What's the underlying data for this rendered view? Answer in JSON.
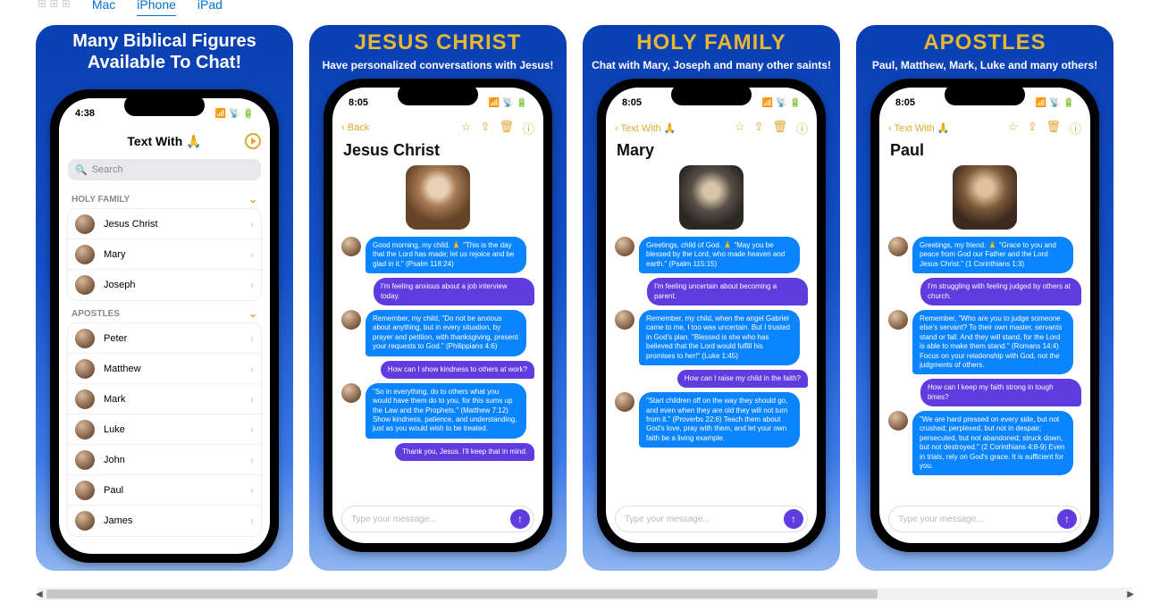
{
  "top_tabs": {
    "mac": "Mac",
    "iphone": "iPhone",
    "ipad": "iPad"
  },
  "cards": [
    {
      "title1": "Many Biblical Figures",
      "title2": "Available To Chat!",
      "phone": {
        "time": "4:38",
        "appTitle": "Text With 🙏",
        "searchPlaceholder": "Search",
        "sections": [
          {
            "header": "HOLY FAMILY",
            "items": [
              "Jesus Christ",
              "Mary",
              "Joseph"
            ]
          },
          {
            "header": "APOSTLES",
            "items": [
              "Peter",
              "Matthew",
              "Mark",
              "Luke",
              "John",
              "Paul",
              "James"
            ]
          }
        ]
      }
    },
    {
      "title": "JESUS CHRIST",
      "subtitle": "Have personalized conversations with Jesus!",
      "phone": {
        "time": "8:05",
        "back": "Back",
        "name": "Jesus Christ",
        "messages": [
          {
            "side": "left",
            "text": "Good morning, my child. 🙏  \"This is the day that the Lord has made; let us rejoice and be glad in it.\" (Psalm 118:24)"
          },
          {
            "side": "right",
            "text": "I'm feeling anxious about a job interview today."
          },
          {
            "side": "left",
            "text": "Remember, my child, \"Do not be anxious about anything, but in every situation, by prayer and petition, with thanksgiving, present your requests to God.\" (Philippians 4:6)"
          },
          {
            "side": "right",
            "text": "How can I show kindness to others at work?"
          },
          {
            "side": "left",
            "text": "\"So in everything, do to others what you would have them do to you, for this sums up the Law and the Prophets.\" (Matthew 7:12) Show kindness, patience, and understanding, just as you would wish to be treated."
          },
          {
            "side": "right",
            "text": "Thank you, Jesus. I'll keep that in mind."
          }
        ],
        "inputPlaceholder": "Type your message..."
      }
    },
    {
      "title": "HOLY FAMILY",
      "subtitle": "Chat with Mary, Joseph and many other saints!",
      "phone": {
        "time": "8:05",
        "back": "Text With 🙏",
        "name": "Mary",
        "messages": [
          {
            "side": "left",
            "text": "Greetings, child of God. 🙏  \"May you be blessed by the Lord, who made heaven and earth.\" (Psalm 115:15)"
          },
          {
            "side": "right",
            "text": "I'm feeling uncertain about becoming a parent."
          },
          {
            "side": "left",
            "text": "Remember, my child, when the angel Gabriel came to me, I too was uncertain. But I trusted in God's plan. \"Blessed is she who has believed that the Lord would fulfill his promises to her!\" (Luke 1:45)"
          },
          {
            "side": "right",
            "text": "How can I raise my child in the faith?"
          },
          {
            "side": "left",
            "text": "\"Start children off on the way they should go, and even when they are old they will not turn from it.\" (Proverbs 22:6) Teach them about God's love, pray with them, and let your own faith be a living example."
          }
        ],
        "inputPlaceholder": "Type your message..."
      }
    },
    {
      "title": "APOSTLES",
      "subtitle": "Paul, Matthew, Mark, Luke and many others!",
      "phone": {
        "time": "8:05",
        "back": "Text With 🙏",
        "name": "Paul",
        "messages": [
          {
            "side": "left",
            "text": "Greetings, my friend. 🙏  \"Grace to you and peace from God our Father and the Lord Jesus Christ.\" (1 Corinthians 1:3)"
          },
          {
            "side": "right",
            "text": "I'm struggling with feeling judged by others at church."
          },
          {
            "side": "left",
            "text": "Remember, \"Who are you to judge someone else's servant? To their own master, servants stand or fall. And they will stand, for the Lord is able to make them stand.\" (Romans 14:4) Focus on your relationship with God, not the judgments of others."
          },
          {
            "side": "right",
            "text": "How can I keep my faith strong in tough times?"
          },
          {
            "side": "left",
            "text": "\"We are hard pressed on every side, but not crushed; perplexed, but not in despair; persecuted, but not abandoned; struck down, but not destroyed.\" (2 Corinthians 4:8-9) Even in trials, rely on God's grace. It is sufficient for you."
          }
        ],
        "inputPlaceholder": "Type your message..."
      }
    }
  ]
}
